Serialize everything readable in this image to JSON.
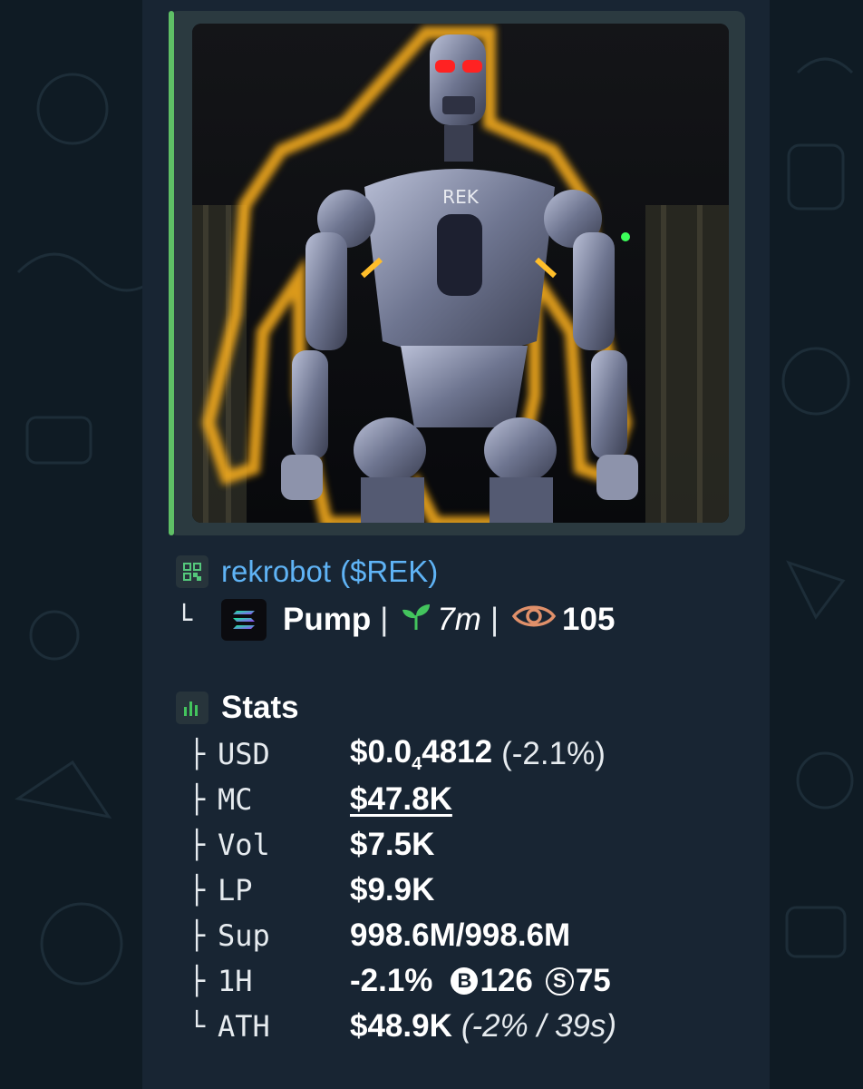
{
  "token": {
    "name": "rekrobot",
    "symbol": "($REK)",
    "image_text": "REK",
    "platform": "Pump",
    "separator": "|",
    "age": "7m",
    "views": "105"
  },
  "stats": {
    "title": "Stats",
    "usd": {
      "label": "USD",
      "value_prefix": "$0.0",
      "value_sub": "4",
      "value_suffix": "4812",
      "change": "(-2.1%)"
    },
    "mc": {
      "label": "MC",
      "value": "$47.8K"
    },
    "vol": {
      "label": "Vol",
      "value": "$7.5K"
    },
    "lp": {
      "label": "LP",
      "value": "$9.9K"
    },
    "sup": {
      "label": "Sup",
      "value": "998.6M/998.6M"
    },
    "h1": {
      "label": "1H",
      "change": "-2.1%",
      "buy_glyph": "B",
      "buys": "126",
      "sell_glyph": "S",
      "sells": "75"
    },
    "ath": {
      "label": "ATH",
      "value": "$48.9K",
      "note": "(-2% / 39s)"
    }
  },
  "colors": {
    "accent_link": "#5fb3f5",
    "bar_green": "#5fbf66",
    "bubble": "#182533",
    "background": "#0f1b24",
    "views_icon": "#e0906a",
    "sprout_icon": "#43c45d"
  },
  "icons": {
    "qr": "qr-code-icon",
    "solana": "solana-logo-icon",
    "sprout": "sprout-icon",
    "eye": "eye-icon",
    "chart": "bar-chart-icon"
  }
}
